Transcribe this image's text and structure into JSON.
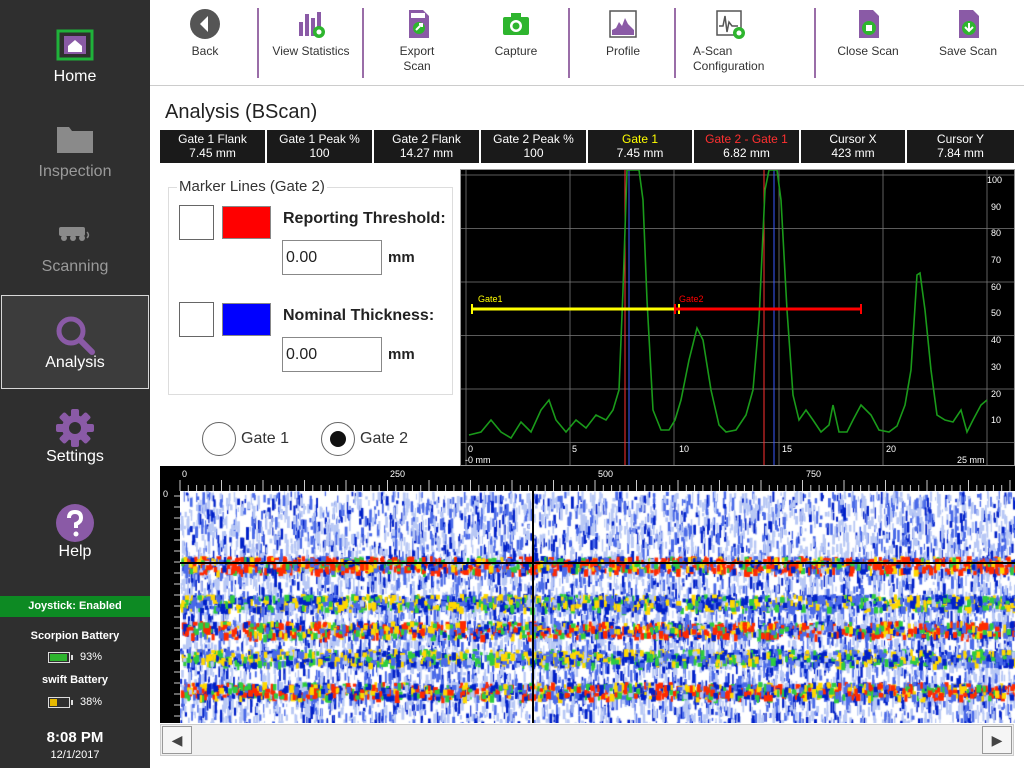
{
  "sidebar": {
    "items": [
      {
        "label": "Home"
      },
      {
        "label": "Inspection"
      },
      {
        "label": "Scanning"
      },
      {
        "label": "Analysis"
      },
      {
        "label": "Settings"
      },
      {
        "label": "Help"
      }
    ],
    "joystick": "Joystick:  Enabled",
    "scorpion_label": "Scorpion Battery",
    "scorpion_pct": "93%",
    "scorpion_level": 0.93,
    "swift_label": "swift Battery",
    "swift_pct": "38%",
    "swift_level": 0.38,
    "time": "8:08 PM",
    "date": "12/1/2017"
  },
  "toolbar": {
    "back": "Back",
    "view_stats": "View Statistics",
    "export_scan": "Export Scan",
    "capture": "Capture",
    "profile": "Profile",
    "ascan_config": "A-Scan Configuration",
    "close_scan": "Close Scan",
    "save_scan": "Save Scan"
  },
  "title": "Analysis (BScan)",
  "stats": [
    {
      "label": "Gate 1 Flank",
      "value": "7.45 mm"
    },
    {
      "label": "Gate 1 Peak %",
      "value": "100"
    },
    {
      "label": "Gate 2 Flank",
      "value": "14.27 mm"
    },
    {
      "label": "Gate 2 Peak %",
      "value": "100"
    },
    {
      "label": "Gate 1",
      "value": "7.45 mm"
    },
    {
      "label": "Gate 2 - Gate 1",
      "value": "6.82 mm"
    },
    {
      "label": "Cursor X",
      "value": "423 mm"
    },
    {
      "label": "Cursor Y",
      "value": "7.84 mm"
    }
  ],
  "markers": {
    "title": "Marker Lines (Gate 2)",
    "reporting_label": "Reporting Threshold:",
    "reporting_value": "0.00",
    "reporting_color": "#ff0000",
    "nominal_label": "Nominal Thickness:",
    "nominal_value": "0.00",
    "nominal_color": "#0000ff",
    "unit": "mm"
  },
  "gate_radio": {
    "gate1": "Gate 1",
    "gate2": "Gate 2",
    "selected": "Gate 2"
  },
  "ascan": {
    "x_ticks": [
      "0",
      "5",
      "10",
      "15",
      "20"
    ],
    "x_start": "-0 mm",
    "x_end": "25 mm",
    "y_ticks": [
      "10",
      "20",
      "30",
      "40",
      "50",
      "60",
      "70",
      "80",
      "90",
      "100"
    ],
    "gate1_label": "Gate1",
    "gate2_label": "Gate2",
    "gate1_color": "#ffff00",
    "gate2_color": "#ff0000",
    "signal_color": "#1a9a1a"
  },
  "bscan": {
    "x_ticks": [
      "0",
      "250",
      "500",
      "750"
    ],
    "y_start": "0"
  }
}
